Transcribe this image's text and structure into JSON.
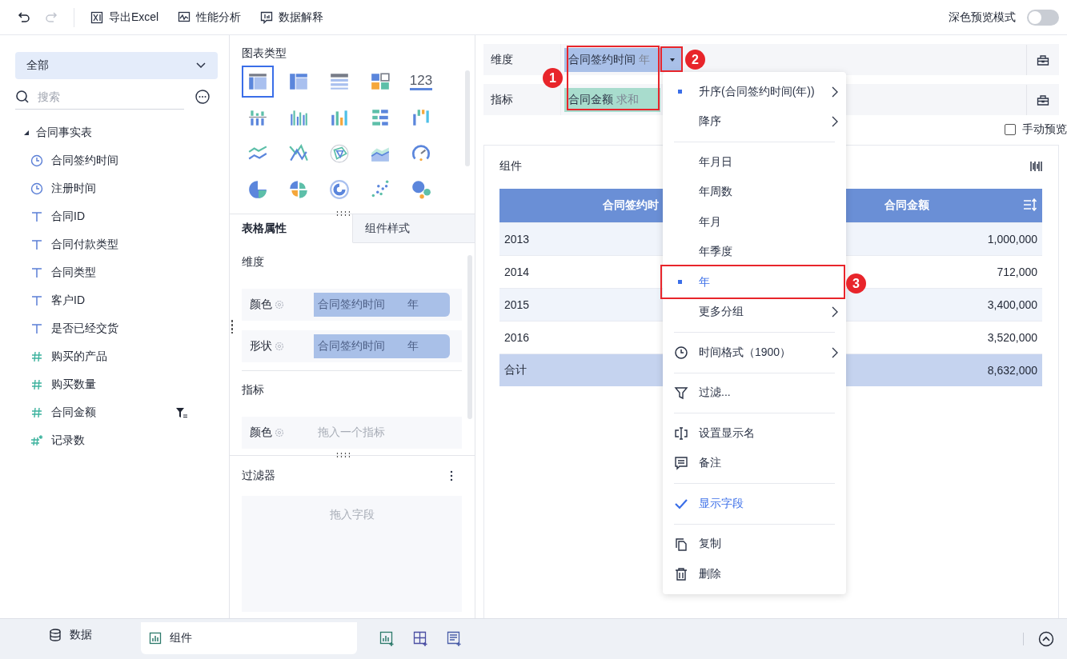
{
  "toolbar": {
    "undo_disabled": false,
    "redo_disabled": true,
    "buttons": [
      {
        "label": "导出Excel"
      },
      {
        "label": "性能分析"
      },
      {
        "label": "数据解释"
      }
    ],
    "dark_preview": {
      "label": "深色预览模式",
      "on": false
    }
  },
  "data_panel": {
    "source": "全部",
    "search": {
      "placeholder": "搜索"
    },
    "tree": [
      {
        "name": "合同事实表",
        "expanded": true,
        "children": [
          {
            "name": "合同签约时间",
            "kind": "time",
            "filtered": false
          },
          {
            "name": "注册时间",
            "kind": "time",
            "filtered": false
          },
          {
            "name": "合同ID",
            "kind": "text",
            "filtered": false
          },
          {
            "name": "合同付款类型",
            "kind": "text",
            "filtered": false
          },
          {
            "name": "合同类型",
            "kind": "text",
            "filtered": false
          },
          {
            "name": "客户ID",
            "kind": "text",
            "filtered": false
          },
          {
            "name": "是否已经交货",
            "kind": "text",
            "filtered": false
          },
          {
            "name": "购买的产品",
            "kind": "number",
            "filtered": false
          },
          {
            "name": "购买数量",
            "kind": "number",
            "filtered": false
          },
          {
            "name": "合同金额",
            "kind": "number",
            "filtered": true
          },
          {
            "name": "记录数",
            "kind": "count",
            "filtered": false
          }
        ]
      }
    ]
  },
  "chart_types": {
    "title": "图表类型",
    "items": [
      {
        "kind": "table",
        "selected": true
      },
      {
        "kind": "cross-table",
        "selected": false
      },
      {
        "kind": "detail-table",
        "selected": false
      },
      {
        "kind": "card",
        "selected": false
      },
      {
        "kind": "number",
        "label": "123",
        "selected": false
      },
      {
        "kind": "stacked-column",
        "selected": false
      },
      {
        "kind": "grouped-column",
        "selected": false
      },
      {
        "kind": "column",
        "selected": false
      },
      {
        "kind": "bar",
        "selected": false
      },
      {
        "kind": "waterfall",
        "selected": false
      },
      {
        "kind": "line",
        "selected": false
      },
      {
        "kind": "polyline",
        "selected": false
      },
      {
        "kind": "radar",
        "selected": false
      },
      {
        "kind": "area",
        "selected": false
      },
      {
        "kind": "gauge",
        "selected": false
      },
      {
        "kind": "pie",
        "selected": false
      },
      {
        "kind": "rose",
        "selected": false
      },
      {
        "kind": "ring",
        "selected": false
      },
      {
        "kind": "scatter",
        "selected": false
      },
      {
        "kind": "bubble",
        "selected": false
      }
    ]
  },
  "property_tabs": [
    {
      "label": "表格属性",
      "selected": true
    },
    {
      "label": "组件样式",
      "selected": false
    }
  ],
  "properties": {
    "sections": [
      {
        "title": "维度",
        "rows": [
          {
            "label": "颜色",
            "field": "合同签约时间",
            "unit": "年"
          },
          {
            "label": "形状",
            "field": "合同签约时间",
            "unit": "年"
          }
        ]
      },
      {
        "title": "指标",
        "rows": [
          {
            "label": "颜色",
            "placeholder": "拖入一个指标"
          }
        ]
      }
    ]
  },
  "filter_panel": {
    "title": "过滤器",
    "placeholder": "拖入字段"
  },
  "shelves": [
    {
      "label": "维度",
      "chip": {
        "kind": "dimension",
        "field": "合同签约时间",
        "unit": "年"
      }
    },
    {
      "label": "指标",
      "chip": {
        "kind": "measure",
        "field": "合同金额",
        "unit": "求和"
      }
    }
  ],
  "manual_preview": {
    "label": "手动预览",
    "checked": false
  },
  "widget": {
    "title": "组件",
    "table": {
      "columns": [
        "合同签约时",
        "合同金额"
      ],
      "rows": [
        [
          "2013",
          "1,000,000"
        ],
        [
          "2014",
          "712,000"
        ],
        [
          "2015",
          "3,400,000"
        ],
        [
          "2016",
          "3,520,000"
        ]
      ],
      "total": [
        "合计",
        "8,632,000"
      ]
    }
  },
  "menu": {
    "groups": [
      [
        {
          "kind": "sort",
          "label": "升序(合同签约时间(年))",
          "selected": true,
          "submenu": true
        },
        {
          "kind": "sort",
          "label": "降序",
          "selected": false,
          "submenu": true
        }
      ],
      [
        {
          "kind": "group",
          "label": "年月日",
          "selected": false,
          "submenu": false
        },
        {
          "kind": "group",
          "label": "年周数",
          "selected": false,
          "submenu": false
        },
        {
          "kind": "group",
          "label": "年月",
          "selected": false,
          "submenu": false
        },
        {
          "kind": "group",
          "label": "年季度",
          "selected": false,
          "submenu": false
        },
        {
          "kind": "group",
          "label": "年",
          "selected": true,
          "submenu": false
        },
        {
          "kind": "group",
          "label": "更多分组",
          "selected": false,
          "submenu": true
        }
      ],
      [
        {
          "kind": "action",
          "label": "时间格式（1900）",
          "submenu": true
        }
      ],
      [
        {
          "kind": "action",
          "label": "过滤...",
          "submenu": false
        }
      ],
      [
        {
          "kind": "action",
          "label": "设置显示名",
          "submenu": false
        },
        {
          "kind": "action",
          "label": "备注",
          "submenu": false
        }
      ],
      [
        {
          "kind": "toggle",
          "label": "显示字段",
          "checked": true,
          "submenu": false
        }
      ],
      [
        {
          "kind": "action",
          "label": "复制",
          "submenu": false
        },
        {
          "kind": "action",
          "label": "删除",
          "submenu": false
        }
      ]
    ]
  },
  "annotations": [
    {
      "label": "1"
    },
    {
      "label": "2"
    },
    {
      "label": "3"
    }
  ],
  "bottom_tabs": [
    {
      "label": "数据",
      "selected": false
    },
    {
      "label": "组件",
      "selected": true
    }
  ]
}
